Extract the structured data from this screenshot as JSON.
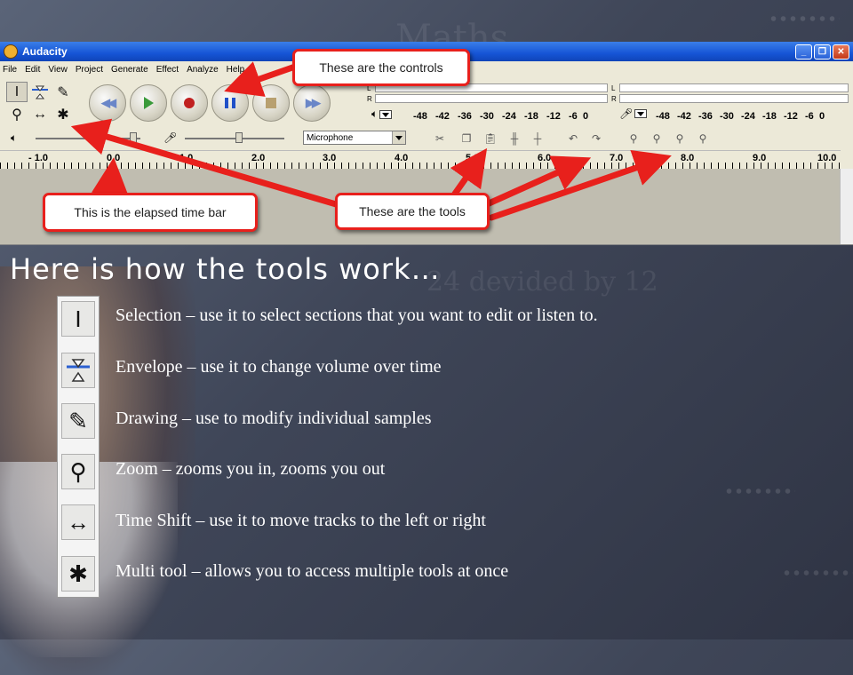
{
  "window": {
    "title": "Audacity",
    "controls": {
      "minimize": "_",
      "maximize": "❐",
      "close": "✕"
    }
  },
  "menu": [
    "File",
    "Edit",
    "View",
    "Project",
    "Generate",
    "Effect",
    "Analyze",
    "Help"
  ],
  "meters": {
    "channels": [
      "L",
      "R"
    ],
    "scale": [
      "-48",
      "-42",
      "-36",
      "-30",
      "-24",
      "-18",
      "-12",
      "-6",
      "0"
    ]
  },
  "input_source": "Microphone",
  "ruler": [
    "- 1.0",
    "0.0",
    "1.0",
    "2.0",
    "3.0",
    "4.0",
    "5.0",
    "6.0",
    "7.0",
    "8.0",
    "9.0",
    "10.0"
  ],
  "callouts": {
    "controls": "These are the controls",
    "timebar": "This is the elapsed time bar",
    "tools": "These are the tools"
  },
  "heading": "Here is how the tools work…",
  "tool_descriptions": [
    {
      "icon": "selection-icon",
      "glyph": "I",
      "text": "Selection – use it to select sections that you want to edit or listen to."
    },
    {
      "icon": "envelope-icon",
      "glyph": "",
      "text": "Envelope – use it to change volume over time"
    },
    {
      "icon": "pencil-icon",
      "glyph": "✎",
      "text": "Drawing – use to modify individual samples"
    },
    {
      "icon": "zoom-icon",
      "glyph": "⚲",
      "text": "Zoom – zooms you in, zooms you out"
    },
    {
      "icon": "time-shift-icon",
      "glyph": "↔",
      "text": "Time Shift – use it to move tracks to the left or right"
    },
    {
      "icon": "multi-tool-icon",
      "glyph": "✱",
      "text": "Multi tool – allows you to access multiple tools at once"
    }
  ],
  "background_chalk": [
    "Maths",
    "24 devided by 12"
  ],
  "colors": {
    "callout_border": "#e8201c",
    "titlebar": "#1655d6",
    "slide_bg": "#3f4658"
  }
}
